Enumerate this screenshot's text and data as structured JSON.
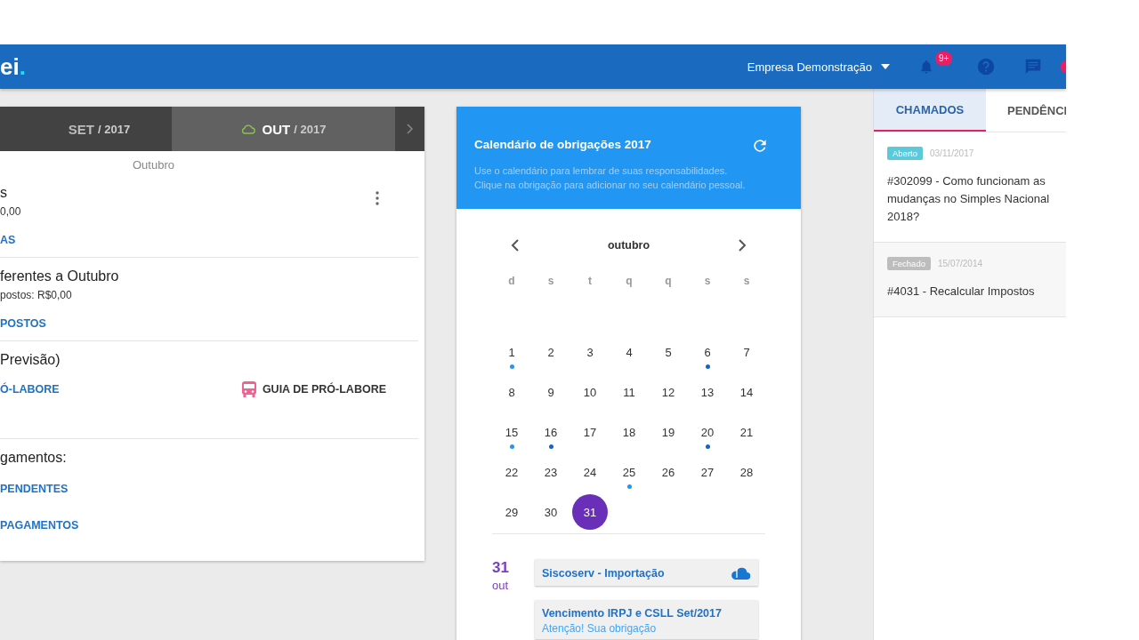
{
  "header": {
    "logo": "ei",
    "logo_dot": ".",
    "company": "Empresa Demonstração",
    "notifications_badge": "9+"
  },
  "months": {
    "tabs": [
      {
        "label": "SET",
        "year": "/ 2017",
        "selected": false
      },
      {
        "label": "OUT",
        "year": "/ 2017",
        "selected": true
      }
    ],
    "subtitle": "Outubro",
    "sections": [
      {
        "title": "s",
        "subtitle": "0,00",
        "links": [
          "AS"
        ],
        "menu": true
      },
      {
        "title": "ferentes a Outubro",
        "subtitle": "postos: R$0,00",
        "links": [
          "POSTOS"
        ]
      },
      {
        "title": "Previsão)",
        "links": [
          "Ó-LABORE"
        ],
        "guide": "GUIA DE PRÓ-LABORE"
      },
      {
        "title": "gamentos:",
        "links": [
          "PENDENTES",
          "PAGAMENTOS"
        ]
      }
    ]
  },
  "calendar": {
    "title": "Calendário de obrigações 2017",
    "description": "Use o calendário para lembrar de suas responsabilidades.\nClique na obrigação para adicionar no seu calendário pessoal.",
    "month": "outubro",
    "weekdays": [
      "d",
      "s",
      "t",
      "q",
      "q",
      "s",
      "s"
    ],
    "days": [
      {
        "day": "1",
        "selected": false,
        "color": "#2196f3"
      },
      {
        "day": "2",
        "selected": false
      },
      {
        "day": "3",
        "selected": false
      },
      {
        "day": "4",
        "selected": false
      },
      {
        "day": "5",
        "selected": false
      },
      {
        "day": "6",
        "selected": false,
        "color": "#1565c0"
      },
      {
        "day": "7",
        "selected": false
      },
      {
        "day": "8",
        "selected": false
      },
      {
        "day": "9",
        "selected": false
      },
      {
        "day": "10",
        "selected": false
      },
      {
        "day": "11",
        "selected": false
      },
      {
        "day": "12",
        "selected": false
      },
      {
        "day": "13",
        "selected": false
      },
      {
        "day": "14",
        "selected": false
      },
      {
        "day": "15",
        "selected": false,
        "color": "#2196f3"
      },
      {
        "day": "16",
        "selected": false,
        "color": "#1565c0"
      },
      {
        "day": "17",
        "selected": false
      },
      {
        "day": "18",
        "selected": false
      },
      {
        "day": "19",
        "selected": false
      },
      {
        "day": "20",
        "selected": false,
        "color": "#1565c0"
      },
      {
        "day": "21",
        "selected": false
      },
      {
        "day": "22",
        "selected": false
      },
      {
        "day": "23",
        "selected": false
      },
      {
        "day": "24",
        "selected": false
      },
      {
        "day": "25",
        "selected": false,
        "color": "#2196f3"
      },
      {
        "day": "26",
        "selected": false
      },
      {
        "day": "27",
        "selected": false
      },
      {
        "day": "28",
        "selected": false
      },
      {
        "day": "29",
        "selected": false
      },
      {
        "day": "30",
        "selected": false
      },
      {
        "day": "31",
        "selected": true
      }
    ],
    "event_day": "31",
    "event_month": "out",
    "events": [
      {
        "title": "Siscoserv - Importação",
        "kind": "cloud"
      },
      {
        "title": "Vencimento IRPJ e CSLL Set/2017",
        "text": "Atenção! Sua obrigação",
        "kind": "plain"
      }
    ]
  },
  "support": {
    "tabs": [
      {
        "label": "CHAMADOS",
        "selected": true
      },
      {
        "label": "PENDÊNCI",
        "selected": false
      }
    ],
    "tickets": [
      {
        "status": "Aberto",
        "color": "#5bc8dc",
        "date": "03/11/2017",
        "title": "#302099 - Como funcionam as mudanças no Simples Nacional 2018?"
      },
      {
        "status": "Fechado",
        "color": "#bdbdbd",
        "date": "15/07/2014",
        "title": "#4031 - Recalcular Impostos"
      }
    ]
  }
}
